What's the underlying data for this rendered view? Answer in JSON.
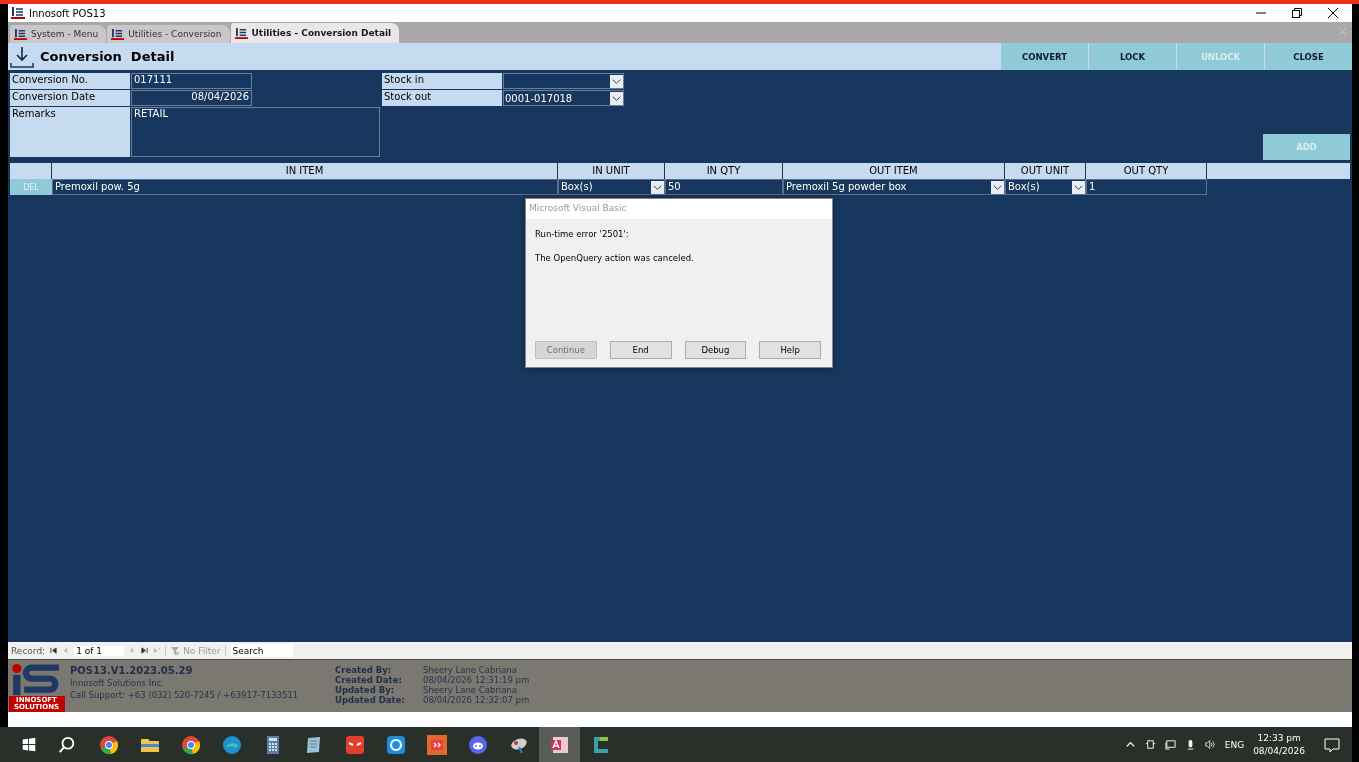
{
  "window": {
    "title": "Innosoft POS13"
  },
  "tabs": [
    {
      "label": "System - Menu",
      "selected": false
    },
    {
      "label": "Utilities - Conversion",
      "selected": false
    },
    {
      "label": "Utilities - Conversion Detail",
      "selected": true
    }
  ],
  "header": {
    "title": "Conversion  Detail",
    "buttons": [
      {
        "label": "CONVERT",
        "disabled": false
      },
      {
        "label": "LOCK",
        "disabled": false
      },
      {
        "label": "UNLOCK",
        "disabled": true
      },
      {
        "label": "CLOSE",
        "disabled": false
      }
    ]
  },
  "form": {
    "fields": [
      {
        "label": "Conversion No.",
        "value": "017111"
      },
      {
        "label": "Conversion Date",
        "value": "08/04/2026"
      },
      {
        "label": "Remarks",
        "value": "RETAIL"
      }
    ],
    "stock": [
      {
        "label": "Stock in"
      },
      {
        "label": "Stock out",
        "value": "0001-017018"
      }
    ],
    "add_button": {
      "label": "ADD",
      "disabled": true
    }
  },
  "table": {
    "columns": [
      "IN ITEM",
      "IN UNIT",
      "IN QTY",
      "OUT ITEM",
      "OUT UNIT",
      "OUT QTY"
    ],
    "rows": [
      {
        "action": "DEL",
        "in_item": "Premoxil pow. 5g",
        "in_unit": "Box(s)",
        "in_qty": "50",
        "out_item": "Premoxil 5g powder box",
        "out_unit": "Box(s)",
        "out_qty": "1"
      }
    ]
  },
  "dialog": {
    "title": "Microsoft Visual Basic",
    "error": "Run-time error '2501':",
    "message": "The OpenQuery action was canceled.",
    "buttons": [
      {
        "label": "Continue",
        "disabled": true
      },
      {
        "label": "End",
        "disabled": false
      },
      {
        "label": "Debug",
        "disabled": false
      },
      {
        "label": "Help",
        "disabled": false
      }
    ]
  },
  "record_nav": {
    "label": "Record:",
    "position": "1 of 1",
    "filter": "No Filter",
    "search_placeholder": "Search"
  },
  "footer": {
    "logo_lines": [
      "INNOSOFT",
      "SOLUTIONS"
    ],
    "version": "POS13.V1.2023.05.29",
    "company": "Innosoft Solutions Inc.",
    "support": "Call Support: +63 (032) 520-7245 / +63917-7133511",
    "audit": [
      {
        "label": "Created By:",
        "value": "Sheery Lane Cabriana"
      },
      {
        "label": "Created Date:",
        "value": "08/04/2026 12:31:19 pm"
      },
      {
        "label": "Updated By:",
        "value": "Sheery Lane Cabriana"
      },
      {
        "label": "Updated Date:",
        "value": "08/04/2026 12:32:07 pm"
      }
    ]
  },
  "taskbar": {
    "apps": [
      {
        "kind": "chrome",
        "active": false
      },
      {
        "kind": "folder",
        "active": false
      },
      {
        "kind": "chrome",
        "active": false
      },
      {
        "kind": "edge",
        "active": false
      },
      {
        "kind": "calculator",
        "active": false
      },
      {
        "kind": "notepad",
        "active": false
      },
      {
        "kind": "mask",
        "active": false
      },
      {
        "kind": "sync",
        "active": false
      },
      {
        "kind": "remote",
        "active": false
      },
      {
        "kind": "chat",
        "active": false
      },
      {
        "kind": "satellite",
        "active": false
      },
      {
        "kind": "access",
        "active": true
      },
      {
        "kind": "bracket",
        "active": false
      }
    ],
    "language": "ENG",
    "time": "12:33 pm",
    "date": "08/04/2026"
  }
}
